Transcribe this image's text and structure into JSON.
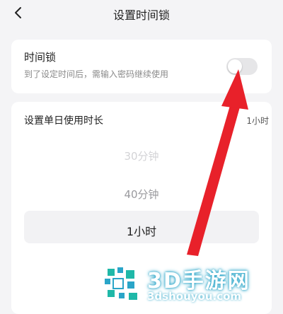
{
  "header": {
    "title": "设置时间锁",
    "back_icon": "chevron-left-icon"
  },
  "time_lock": {
    "title": "时间锁",
    "description": "到了设定时间后，需输入密码继续使用",
    "toggle_state": "off"
  },
  "duration": {
    "title": "设置单日使用时长",
    "current_value": "1小时",
    "options": [
      "30分钟",
      "40分钟",
      "1小时"
    ],
    "selected_index": 2
  },
  "watermark": {
    "name": "3D手游网",
    "url": "3dshouyou.com"
  },
  "colors": {
    "background": "#f4f4f6",
    "card": "#ffffff",
    "toggle_off": "#e6e6e8",
    "arrow": "#e8212a",
    "watermark_accent": "#2aa5c8"
  }
}
